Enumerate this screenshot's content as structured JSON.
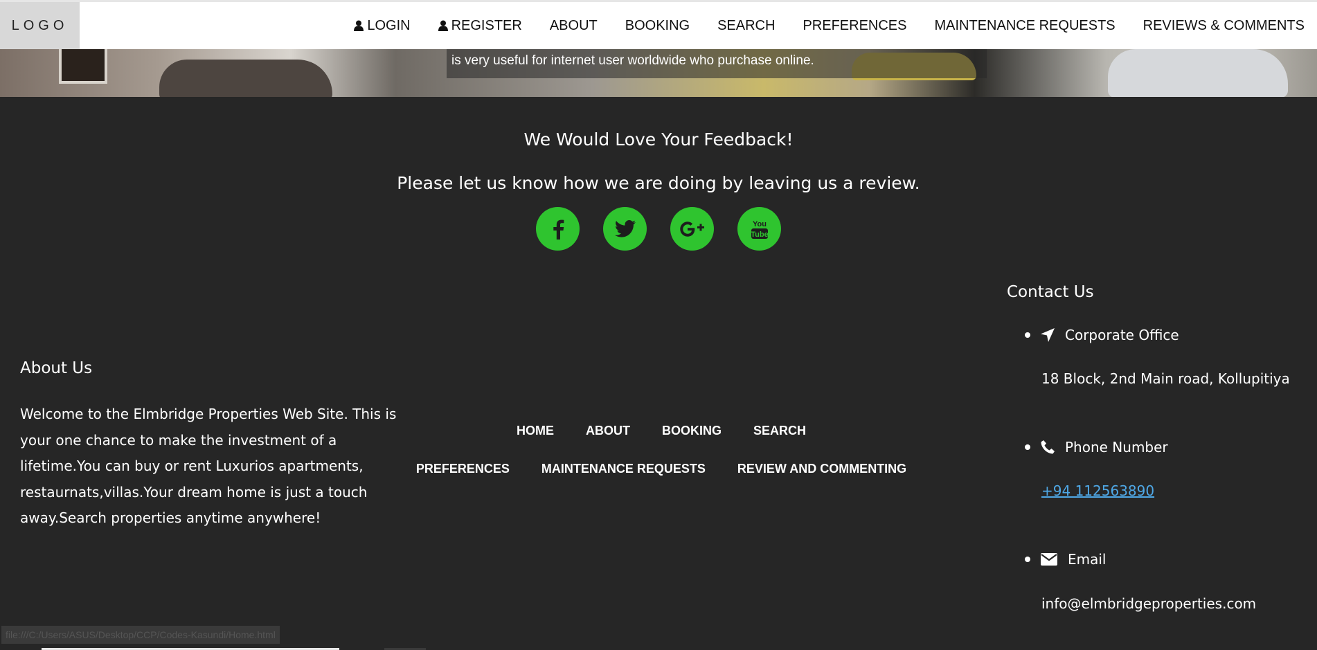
{
  "header": {
    "logo": "LOGO",
    "nav": [
      {
        "label": "LOGIN",
        "icon": "user-icon"
      },
      {
        "label": "REGISTER",
        "icon": "user-icon"
      },
      {
        "label": "ABOUT"
      },
      {
        "label": "BOOKING"
      },
      {
        "label": "SEARCH"
      },
      {
        "label": "PREFERENCES"
      },
      {
        "label": "MAINTENANCE REQUESTS"
      },
      {
        "label": "REVIEWS & COMMENTS"
      }
    ]
  },
  "hero": {
    "text": "is very useful for internet user worldwide who purchase online."
  },
  "feedback": {
    "title": "We Would Love Your Feedback!",
    "subtitle": "Please let us know how we are doing by leaving us a review.",
    "socials": [
      {
        "name": "facebook-icon"
      },
      {
        "name": "twitter-icon"
      },
      {
        "name": "google-plus-icon"
      },
      {
        "name": "youtube-icon"
      }
    ],
    "accent_color": "#2fc42f"
  },
  "about": {
    "title": "About Us",
    "text": "Welcome to the Elmbridge Properties Web Site. This is your one chance to make the investment of a lifetime.You can buy or rent Luxurios apartments, restaurnats,villas.Your dream home is just a touch away.Search properties anytime anywhere!"
  },
  "footer_links": {
    "row1": [
      "HOME",
      "ABOUT",
      "BOOKING",
      "SEARCH"
    ],
    "row2": [
      "PREFERENCES",
      "MAINTENANCE REQUESTS",
      "REVIEW AND COMMENTING"
    ]
  },
  "contact": {
    "title": "Contact Us",
    "office_label": "Corporate Office",
    "office_value": "18 Block, 2nd Main road, Kollupitiya",
    "phone_label": "Phone Number",
    "phone_value": "+94 112563890",
    "email_label": "Email",
    "email_value": "info@elmbridgeproperties.com"
  },
  "status": {
    "url": "file:///C:/Users/ASUS/Desktop/CCP/Codes-Kasundi/Home.html"
  }
}
